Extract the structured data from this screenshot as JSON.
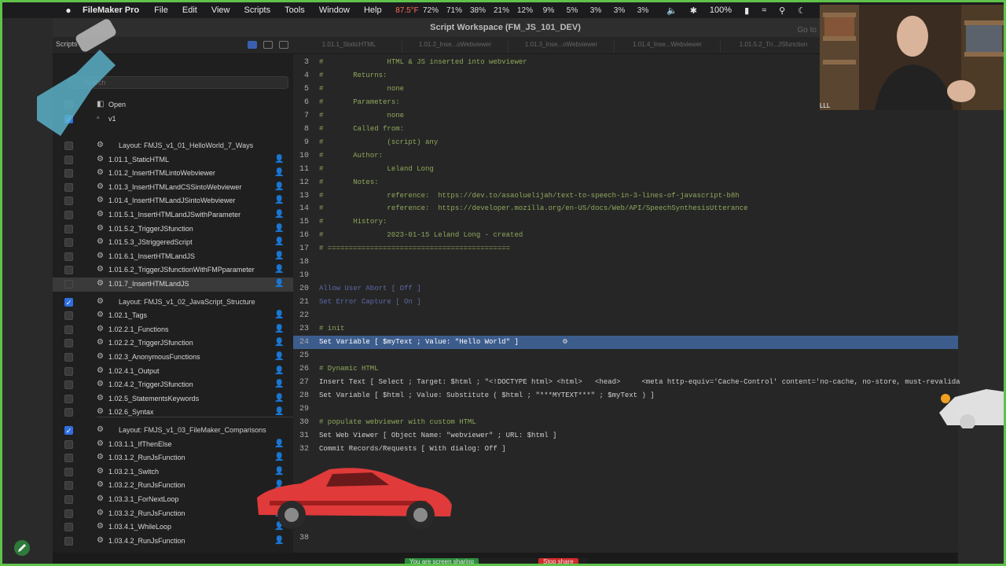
{
  "menubar": {
    "app_name": "FileMaker Pro",
    "menus": [
      "File",
      "Edit",
      "View",
      "Scripts",
      "Tools",
      "Window",
      "Help"
    ],
    "stats": [
      "87.5°F",
      "72%",
      "71%",
      "38%",
      "21%",
      "12%",
      "9%",
      "5%",
      "3%",
      "3%",
      "3%"
    ],
    "battery": "100%"
  },
  "window": {
    "title": "Script Workspace (FM_JS_101_DEV)",
    "goto_label": "Go to",
    "sidebar_label": "Scripts",
    "search_placeholder": "Search"
  },
  "tabs": [
    "1.01.1_StaticHTML",
    "1.01.2_Inse...oWebviewer",
    "1.01.3_Inse...oWebviewer",
    "1.01.4_Inse...Webviewer",
    "1.01.5.2_Tri...JSfunction"
  ],
  "sidebar": {
    "open_label": "Open",
    "folder_label": "v1",
    "rows": [
      {
        "type": "layout",
        "label": "Layout: FMJS_v1_01_HelloWorld_7_Ways",
        "checked": false
      },
      {
        "type": "script",
        "label": "1.01.1_StaticHTML"
      },
      {
        "type": "script",
        "label": "1.01.2_InsertHTMLintoWebviewer"
      },
      {
        "type": "script",
        "label": "1.01.3_InsertHTMLandCSSintoWebviewer"
      },
      {
        "type": "script",
        "label": "1.01.4_InsertHTMLandJSintoWebviewer"
      },
      {
        "type": "script",
        "label": "1.01.5.1_InsertHTMLandJSwithParameter"
      },
      {
        "type": "script",
        "label": "1.01.5.2_TriggerJSfunction"
      },
      {
        "type": "script",
        "label": "1.01.5.3_JStriggeredScript"
      },
      {
        "type": "script",
        "label": "1.01.6.1_InsertHTMLandJS"
      },
      {
        "type": "script",
        "label": "1.01.6.2_TriggerJSfunctionWithFMPparameter"
      },
      {
        "type": "script",
        "label": "1.01.7_InsertHTMLandJS",
        "selected": true
      },
      {
        "type": "layout",
        "label": "Layout: FMJS_v1_02_JavaScript_Structure",
        "checked": true
      },
      {
        "type": "script",
        "label": "1.02.1_Tags"
      },
      {
        "type": "script",
        "label": "1.02.2.1_Functions"
      },
      {
        "type": "script",
        "label": "1.02.2.2_TriggerJSfunction"
      },
      {
        "type": "script",
        "label": "1.02.3_AnonymousFunctions"
      },
      {
        "type": "script",
        "label": "1.02.4.1_Output"
      },
      {
        "type": "script",
        "label": "1.02.4.2_TriggerJSfunction"
      },
      {
        "type": "script",
        "label": "1.02.5_StatementsKeywords"
      },
      {
        "type": "script",
        "label": "1.02.6_Syntax"
      },
      {
        "type": "layout",
        "label": "Layout: FMJS_v1_03_FileMaker_Comparisons",
        "checked": true
      },
      {
        "type": "script",
        "label": "1.03.1.1_IfThenElse"
      },
      {
        "type": "script",
        "label": "1.03.1.2_RunJsFunction"
      },
      {
        "type": "script",
        "label": "1.03.2.1_Switch"
      },
      {
        "type": "script",
        "label": "1.03.2.2_RunJsFunction"
      },
      {
        "type": "script",
        "label": "1.03.3.1_ForNextLoop"
      },
      {
        "type": "script",
        "label": "1.03.3.2_RunJsFunction"
      },
      {
        "type": "script",
        "label": "1.03.4.1_WhileLoop"
      },
      {
        "type": "script",
        "label": "1.03.4.2_RunJsFunction"
      }
    ]
  },
  "editor": {
    "lines": [
      {
        "n": "3",
        "text": "#\t\tHTML & JS inserted into webviewer",
        "cls": "cm"
      },
      {
        "n": "4",
        "text": "#\tReturns:",
        "cls": "cm"
      },
      {
        "n": "5",
        "text": "#\t\tnone",
        "cls": "cm"
      },
      {
        "n": "6",
        "text": "#\tParameters:",
        "cls": "cm"
      },
      {
        "n": "7",
        "text": "#\t\tnone",
        "cls": "cm"
      },
      {
        "n": "8",
        "text": "#\tCalled from:",
        "cls": "cm"
      },
      {
        "n": "9",
        "text": "#\t\t(script) any",
        "cls": "cm"
      },
      {
        "n": "10",
        "text": "#\tAuthor:",
        "cls": "cm"
      },
      {
        "n": "11",
        "text": "#\t\tLeland Long",
        "cls": "cm"
      },
      {
        "n": "12",
        "text": "#\tNotes:",
        "cls": "cm"
      },
      {
        "n": "13",
        "text": "#\t\treference:  https://dev.to/asaoluelijah/text-to-speech-in-3-lines-of-javascript-b8h",
        "cls": "cm"
      },
      {
        "n": "14",
        "text": "#\t\treference:  https://developer.mozilla.org/en-US/docs/Web/API/SpeechSynthesisUtterance",
        "cls": "cm"
      },
      {
        "n": "15",
        "text": "#\tHistory:",
        "cls": "cm"
      },
      {
        "n": "16",
        "text": "#\t\t2023-01-15 Leland Long - created",
        "cls": "cm"
      },
      {
        "n": "17",
        "text": "# ===========================================",
        "cls": "cm"
      },
      {
        "n": "18",
        "text": "",
        "cls": ""
      },
      {
        "n": "19",
        "text": "",
        "cls": ""
      },
      {
        "n": "20",
        "text": "Allow User Abort [ Off ]",
        "cls": "dim"
      },
      {
        "n": "21",
        "text": "Set Error Capture [ On ]",
        "cls": "dim"
      },
      {
        "n": "22",
        "text": "",
        "cls": ""
      },
      {
        "n": "23",
        "text": "# init",
        "cls": "cm"
      },
      {
        "n": "24",
        "text": "Set Variable [ $myText ; Value: \"Hello World\" ]",
        "cls": "",
        "highlight": true
      },
      {
        "n": "25",
        "text": "",
        "cls": ""
      },
      {
        "n": "26",
        "text": "# Dynamic HTML",
        "cls": "cm"
      },
      {
        "n": "27",
        "text": "Insert Text [ Select ; Target: $html ; \"<!DOCTYPE html> <html>   <head>     <meta http-equiv='Cache-Control' content='no-cache, no-store, must-revalida",
        "cls": ""
      },
      {
        "n": "28",
        "text": "Set Variable [ $html ; Value: Substitute ( $html ; \"***MYTEXT***\" ; $myText ) ]",
        "cls": ""
      },
      {
        "n": "29",
        "text": "",
        "cls": ""
      },
      {
        "n": "30",
        "text": "# populate webviewer with custom HTML",
        "cls": "cm"
      },
      {
        "n": "31",
        "text": "Set Web Viewer [ Object Name: \"webviewer\" ; URL: $html ]",
        "cls": ""
      },
      {
        "n": "32",
        "text": "Commit Records/Requests [ With dialog: Off ]",
        "cls": ""
      },
      {
        "n": "38",
        "text": "",
        "cls": ""
      }
    ]
  },
  "share": {
    "sharing_label": "You are screen sharing",
    "stop_label": "Stop share"
  },
  "webcam": {
    "label": "LLL"
  }
}
